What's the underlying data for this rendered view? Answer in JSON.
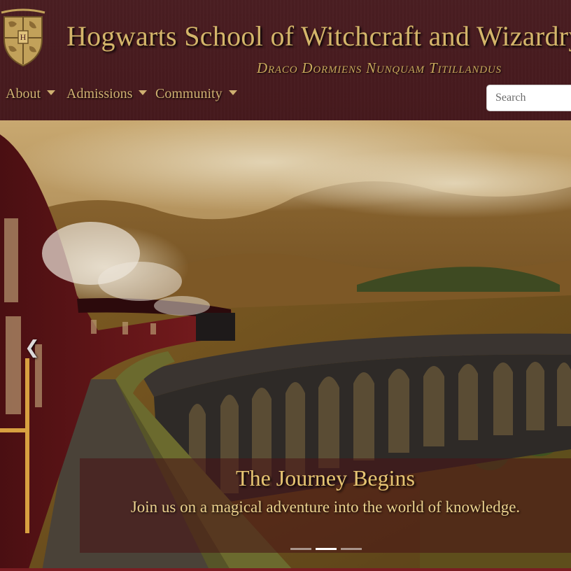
{
  "header": {
    "title": "Hogwarts School of Witchcraft and Wizardry",
    "motto": "Draco Dormiens Nunquam Titillandus",
    "crest_icon": "hogwarts-crest-icon"
  },
  "nav": {
    "items": [
      {
        "label": "About"
      },
      {
        "label": "Admissions"
      },
      {
        "label": "Community"
      }
    ]
  },
  "search": {
    "placeholder": "Search",
    "value": ""
  },
  "carousel": {
    "slide_title": "The Journey Begins",
    "slide_text": "Join us on a magical adventure into the world of knowledge.",
    "prev_icon": "chevron-left-icon",
    "indicator_count": 3,
    "active_indicator": 2
  },
  "colors": {
    "header_bg": "#46191d",
    "gold": "#d4b56a",
    "caption_bg": "#481416",
    "accent_bar": "#7a1d22"
  }
}
